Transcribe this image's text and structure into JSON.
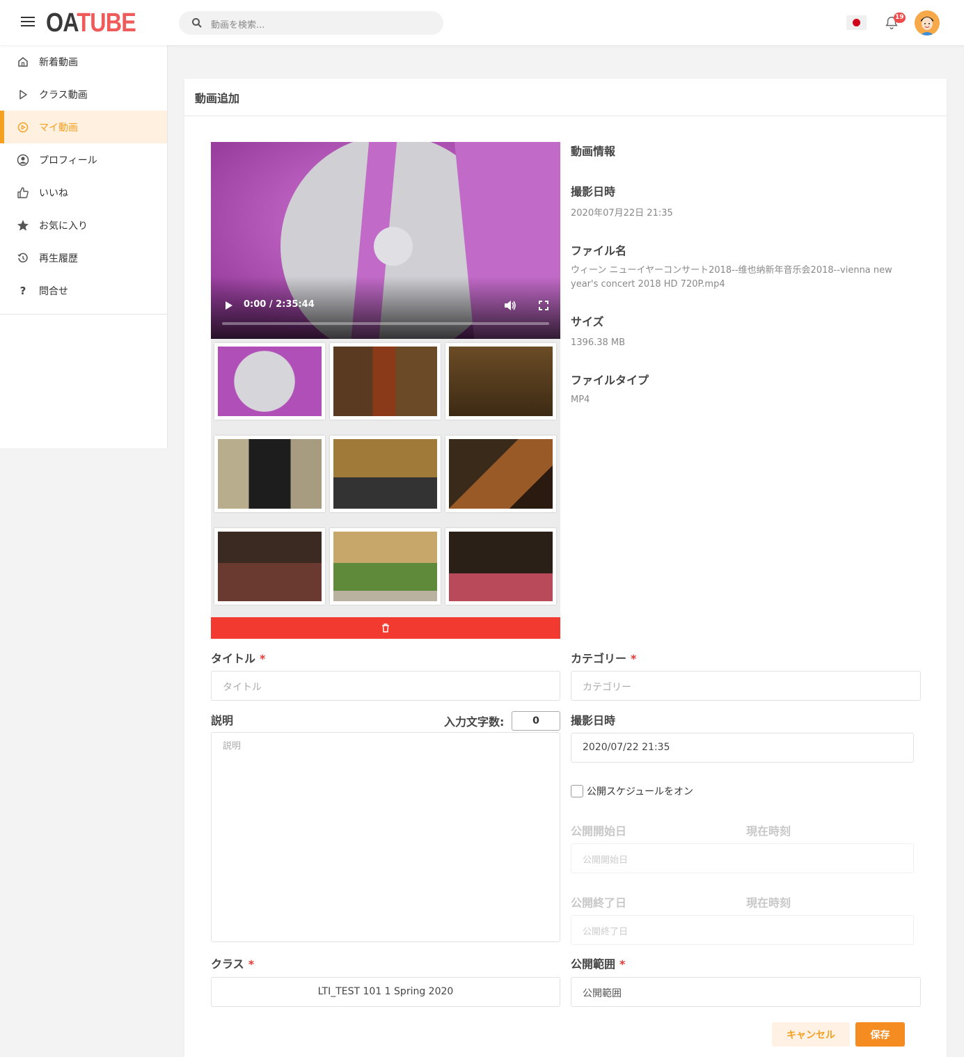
{
  "app": {
    "logo_oa": "OA",
    "logo_tube": "TUBE",
    "search_placeholder": "動画を検索...",
    "notification_count": "19"
  },
  "sidebar": {
    "items": [
      {
        "label": "新着動画",
        "icon": "home-icon"
      },
      {
        "label": "クラス動画",
        "icon": "play-outline-icon"
      },
      {
        "label": "マイ動画",
        "icon": "play-circle-icon",
        "active": true
      },
      {
        "label": "プロフィール",
        "icon": "user-circle-icon"
      },
      {
        "label": "いいね",
        "icon": "thumbs-up-icon"
      },
      {
        "label": "お気に入り",
        "icon": "star-icon"
      },
      {
        "label": "再生履歴",
        "icon": "history-icon"
      },
      {
        "label": "問合せ",
        "icon": "question-icon"
      }
    ]
  },
  "page": {
    "title": "動画追加"
  },
  "player": {
    "time": "0:00 / 2:35:44",
    "progress": 0
  },
  "info": {
    "heading": "動画情報",
    "shot_label": "撮影日時",
    "shot_value": "2020年07月22日 21:35",
    "filename_label": "ファイル名",
    "filename_value": "ウィーン ニューイヤーコンサート2018--维也纳新年音乐会2018--vienna new year's concert 2018 HD 720P.mp4",
    "size_label": "サイズ",
    "size_value": "1396.38 MB",
    "type_label": "ファイルタイプ",
    "type_value": "MP4"
  },
  "form": {
    "title_label": "タイトル",
    "title_placeholder": "タイトル",
    "category_label": "カテゴリー",
    "category_placeholder": "カテゴリー",
    "desc_label": "説明",
    "desc_placeholder": "説明",
    "char_count_label": "入力文字数:",
    "char_count": "0",
    "shot_label": "撮影日時",
    "shot_value": "2020/07/22 21:35",
    "schedule_label": "公開スケジュールをオン",
    "start_label": "公開開始日",
    "start_now": "現在時刻",
    "start_placeholder": "公開開始日",
    "end_label": "公開終了日",
    "end_now": "現在時刻",
    "end_placeholder": "公開終了日",
    "class_label": "クラス",
    "class_value": "LTI_TEST 101 1 Spring 2020",
    "scope_label": "公開範囲",
    "scope_placeholder": "公開範囲",
    "required_mark": "*"
  },
  "buttons": {
    "cancel": "キャンセル",
    "save": "保存"
  },
  "colors": {
    "accent": "#f5a021",
    "danger": "#f33a30",
    "logo_red": "#ef5a5a"
  }
}
